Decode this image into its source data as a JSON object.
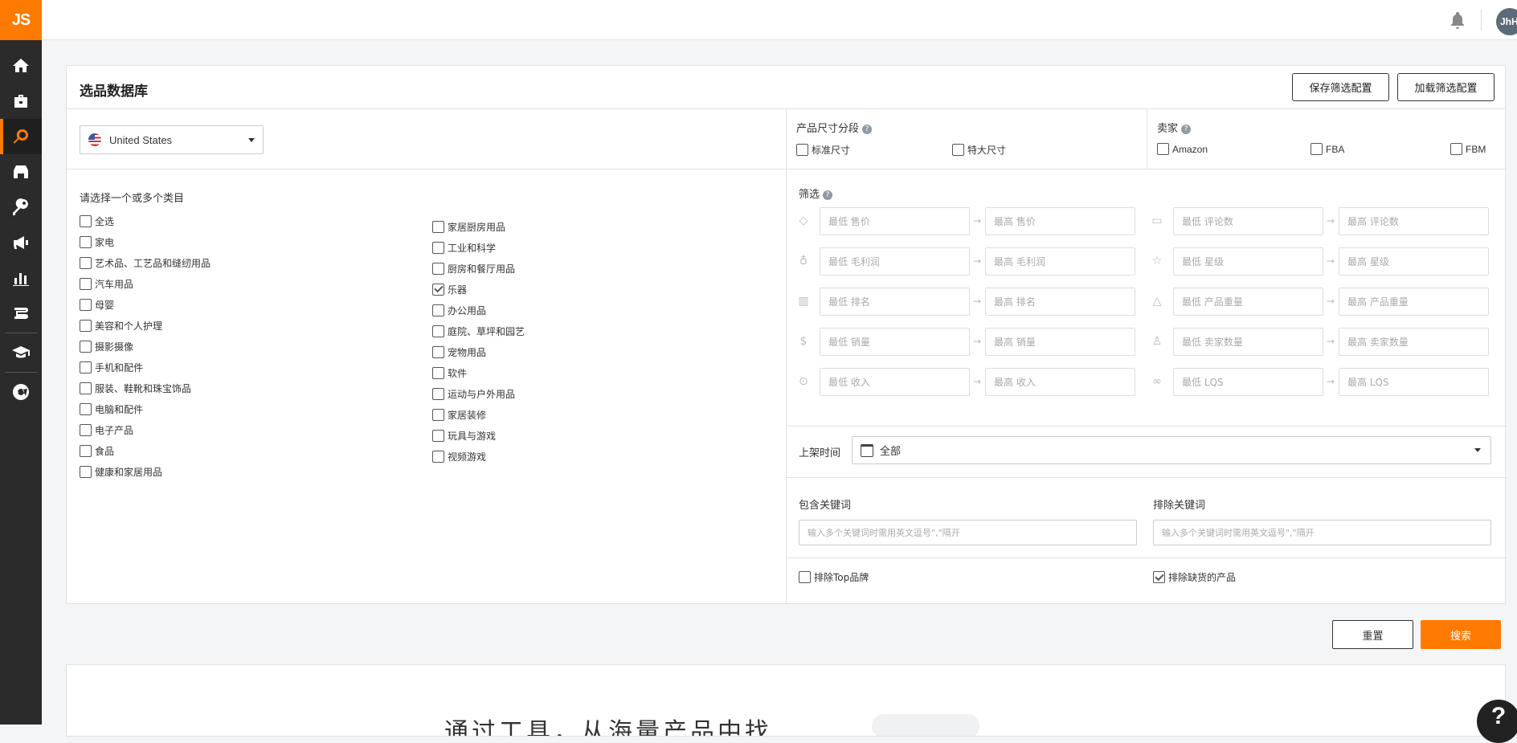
{
  "app": {
    "logo": "JS",
    "avatar": "JhH"
  },
  "sidebar": {
    "items": [
      {
        "icon": "home-icon"
      },
      {
        "icon": "briefcase-icon"
      },
      {
        "icon": "search-icon",
        "active": true
      },
      {
        "icon": "store-icon"
      },
      {
        "icon": "key-icon"
      },
      {
        "icon": "megaphone-icon"
      },
      {
        "icon": "bar-chart-icon"
      },
      {
        "icon": "academy-icon"
      },
      {
        "icon": "graduation-cap-icon"
      },
      {
        "icon": "globe-icon"
      }
    ]
  },
  "card": {
    "title": "选品数据库",
    "save_config": "保存筛选配置",
    "load_config": "加载筛选配置"
  },
  "country": {
    "value": "United States"
  },
  "categories": {
    "title": "请选择一个或多个类目",
    "col1": [
      {
        "label": "全选",
        "checked": false
      },
      {
        "label": "家电",
        "checked": false
      },
      {
        "label": "艺术品、工艺品和缝纫用品",
        "checked": false
      },
      {
        "label": "汽车用品",
        "checked": false
      },
      {
        "label": "母婴",
        "checked": false
      },
      {
        "label": "美容和个人护理",
        "checked": false
      },
      {
        "label": "摄影摄像",
        "checked": false
      },
      {
        "label": "手机和配件",
        "checked": false
      },
      {
        "label": "服装、鞋靴和珠宝饰品",
        "checked": false
      },
      {
        "label": "电脑和配件",
        "checked": false
      },
      {
        "label": "电子产品",
        "checked": false
      },
      {
        "label": "食品",
        "checked": false
      },
      {
        "label": "健康和家居用品",
        "checked": false
      }
    ],
    "col2": [
      {
        "label": "家居厨房用品",
        "checked": false
      },
      {
        "label": "工业和科学",
        "checked": false
      },
      {
        "label": "厨房和餐厅用品",
        "checked": false
      },
      {
        "label": "乐器",
        "checked": true
      },
      {
        "label": "办公用品",
        "checked": false
      },
      {
        "label": "庭院、草坪和园艺",
        "checked": false
      },
      {
        "label": "宠物用品",
        "checked": false
      },
      {
        "label": "软件",
        "checked": false
      },
      {
        "label": "运动与户外用品",
        "checked": false
      },
      {
        "label": "家居装修",
        "checked": false
      },
      {
        "label": "玩具与游戏",
        "checked": false
      },
      {
        "label": "视频游戏",
        "checked": false
      }
    ]
  },
  "size_tier": {
    "title": "产品尺寸分段",
    "standard": "标准尺寸",
    "oversize": "特大尺寸"
  },
  "seller": {
    "title": "卖家",
    "amazon": "Amazon",
    "fba": "FBA",
    "fbm": "FBM"
  },
  "filters": {
    "title": "筛选",
    "left": [
      {
        "icon": "tag-icon",
        "min": "最低 售价",
        "max": "最高 售价"
      },
      {
        "icon": "money-bag-icon",
        "min": "最低 毛利润",
        "max": "最高 毛利润"
      },
      {
        "icon": "ranking-icon",
        "min": "最低 排名",
        "max": "最高 排名"
      },
      {
        "icon": "dollar-icon",
        "min": "最低 销量",
        "max": "最高 销量"
      },
      {
        "icon": "revenue-icon",
        "min": "最低 收入",
        "max": "最高 收入"
      }
    ],
    "right": [
      {
        "icon": "comment-icon",
        "min": "最低 评论数",
        "max": "最高 评论数"
      },
      {
        "icon": "star-icon",
        "min": "最低 星级",
        "max": "最高 星级"
      },
      {
        "icon": "weight-icon",
        "min": "最低 产品重量",
        "max": "最高 产品重量"
      },
      {
        "icon": "sellers-icon",
        "min": "最低 卖家数量",
        "max": "最高 卖家数量"
      },
      {
        "icon": "lqs-icon",
        "min": "最低 LQS",
        "max": "最高 LQS"
      }
    ]
  },
  "listing_date": {
    "label": "上架时间",
    "value": "全部"
  },
  "keywords": {
    "include_label": "包含关键词",
    "exclude_label": "排除关键词",
    "include_placeholder": "输入多个关键词时需用英文逗号\",\"隔开",
    "exclude_placeholder": "输入多个关键词时需用英文逗号\",\"隔开"
  },
  "exclusions": {
    "top_brands": {
      "label": "排除Top品牌",
      "checked": false
    },
    "out_of_stock": {
      "label": "排除缺货的产品",
      "checked": true
    }
  },
  "actions": {
    "reset": "重置",
    "search": "搜索"
  },
  "bottom": {
    "headline": "通过工具，从海量产品中找"
  }
}
